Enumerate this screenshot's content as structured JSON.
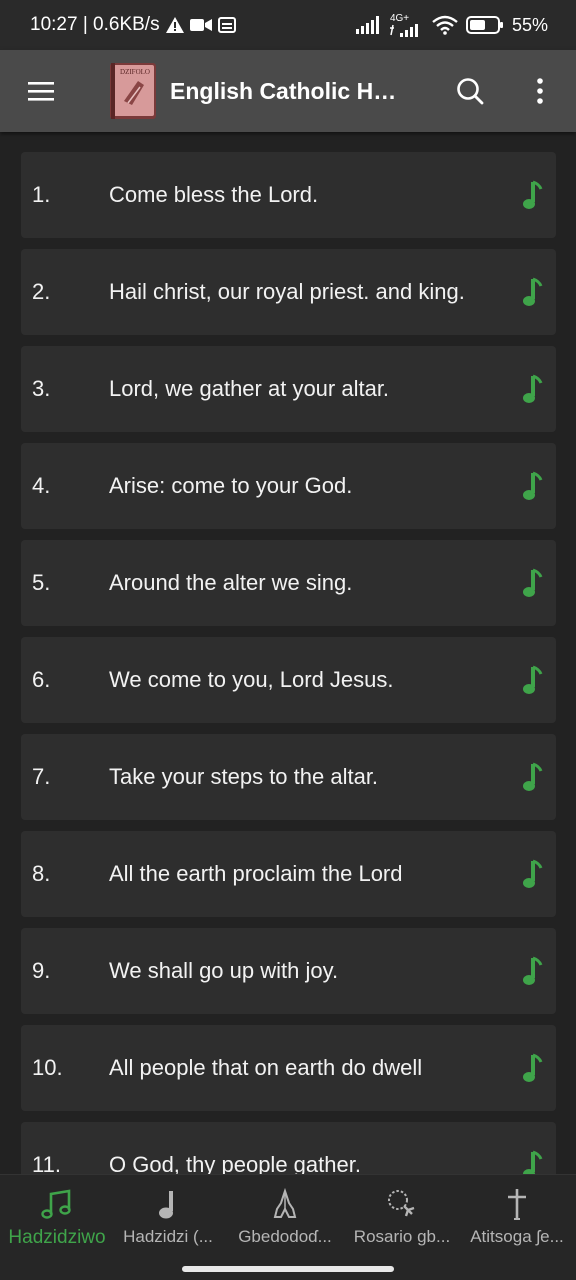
{
  "status": {
    "time_speed": "10:27 | 0.6KB/s",
    "network_label": "4G+",
    "battery": "55%"
  },
  "app_bar": {
    "title": "English Catholic Hy...",
    "logo_text": "DZIFOLO"
  },
  "hymns": [
    {
      "num": "1.",
      "title": "Come bless the Lord."
    },
    {
      "num": "2.",
      "title": "Hail christ, our royal priest. and king."
    },
    {
      "num": "3.",
      "title": "Lord, we gather at your altar."
    },
    {
      "num": "4.",
      "title": "Arise: come to your God."
    },
    {
      "num": "5.",
      "title": "Around the alter we sing."
    },
    {
      "num": "6.",
      "title": "We come to you, Lord Jesus."
    },
    {
      "num": "7.",
      "title": "Take your steps to the altar."
    },
    {
      "num": "8.",
      "title": "All the earth proclaim the Lord"
    },
    {
      "num": "9.",
      "title": "We shall go up with joy."
    },
    {
      "num": "10.",
      "title": "All people that on earth do dwell"
    },
    {
      "num": "11.",
      "title": "O God, thy people gather."
    }
  ],
  "bottom_nav": [
    {
      "label": "Hadzidziwo",
      "icon": "music-notes-icon",
      "active": true
    },
    {
      "label": "Hadzidzi (...",
      "icon": "music-note-icon",
      "active": false
    },
    {
      "label": "Gbedodoɗ...",
      "icon": "praying-hands-icon",
      "active": false
    },
    {
      "label": "Rosario gb...",
      "icon": "rosary-icon",
      "active": false
    },
    {
      "label": "Atitsoga ʃe...",
      "icon": "cross-icon",
      "active": false
    }
  ],
  "colors": {
    "accent": "#3fa44a",
    "background": "#222222",
    "app_bar": "#4a4a4a",
    "row": "#2e2e2e"
  }
}
